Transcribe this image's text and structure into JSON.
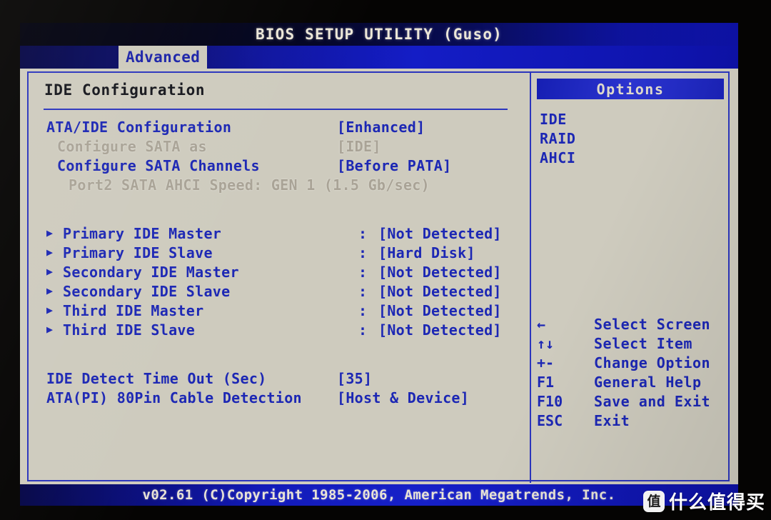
{
  "titlebar": {
    "title": "BIOS SETUP UTILITY (Guso)"
  },
  "menubar": {
    "active_tab": "Advanced"
  },
  "main": {
    "section_title": "IDE Configuration",
    "settings": [
      {
        "label": "ATA/IDE Configuration",
        "value": "[Enhanced]",
        "disabled": false,
        "indent": 0
      },
      {
        "label": "Configure SATA as",
        "value": "[IDE]",
        "disabled": true,
        "indent": 1
      },
      {
        "label": "Configure SATA Channels",
        "value": "[Before PATA]",
        "disabled": false,
        "indent": 1
      },
      {
        "label": "Port2 SATA AHCI Speed: GEN 1 (1.5 Gb/sec)",
        "value": "",
        "disabled": true,
        "indent": 2
      }
    ],
    "devices": [
      {
        "label": "Primary IDE Master",
        "colon": ":",
        "value": "[Not Detected]"
      },
      {
        "label": "Primary IDE Slave",
        "colon": ":",
        "value": "[Hard Disk]"
      },
      {
        "label": "Secondary IDE Master",
        "colon": ":",
        "value": "[Not Detected]"
      },
      {
        "label": "Secondary IDE Slave",
        "colon": ":",
        "value": "[Not Detected]"
      },
      {
        "label": "Third IDE Master",
        "colon": ":",
        "value": "[Not Detected]"
      },
      {
        "label": "Third IDE Slave",
        "colon": ":",
        "value": "[Not Detected]"
      }
    ],
    "footer_settings": [
      {
        "label": "IDE Detect Time Out (Sec)",
        "value": "[35]"
      },
      {
        "label": "ATA(PI) 80Pin Cable Detection",
        "value": "[Host & Device]"
      }
    ]
  },
  "options": {
    "header": "Options",
    "items": [
      "IDE",
      "RAID",
      "AHCI"
    ],
    "keys": [
      {
        "key": "←",
        "desc": "Select Screen"
      },
      {
        "key": "↑↓",
        "desc": "Select Item"
      },
      {
        "key": "+-",
        "desc": "Change Option"
      },
      {
        "key": "F1",
        "desc": "General Help"
      },
      {
        "key": "F10",
        "desc": "Save and Exit"
      },
      {
        "key": "ESC",
        "desc": "Exit"
      }
    ]
  },
  "footer": {
    "copyright": "v02.61 (C)Copyright 1985-2006, American Megatrends, Inc."
  },
  "watermark": {
    "logo_char": "值",
    "text": "什么值得买"
  },
  "colors": {
    "bios_blue": "#1c27b4",
    "bar_blue": "#121bc0",
    "background": "#cfccbf",
    "disabled_text": "#a9a396",
    "heading_text": "#15161c"
  }
}
